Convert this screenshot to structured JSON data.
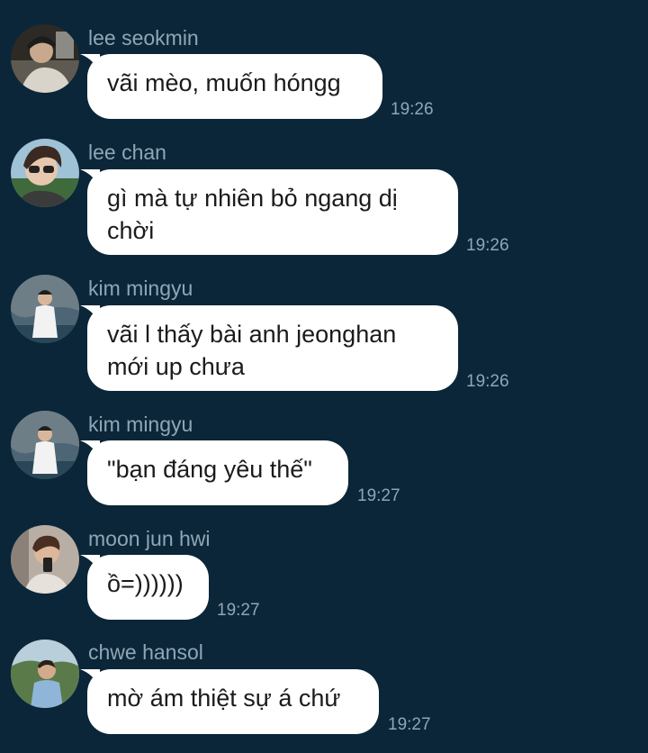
{
  "messages": [
    {
      "sender": "lee seokmin",
      "text": "vãi mèo, muốn hóngg",
      "time": "19:26",
      "avatar": "avatar-photo-lee-seokmin"
    },
    {
      "sender": "lee chan",
      "text": "gì mà tự nhiên bỏ ngang dị chời",
      "time": "19:26",
      "avatar": "avatar-photo-lee-chan"
    },
    {
      "sender": "kim mingyu",
      "text": "vãi l thấy bài anh jeonghan mới up chưa",
      "time": "19:26",
      "avatar": "avatar-photo-kim-mingyu"
    },
    {
      "sender": "kim mingyu",
      "text": "\"bạn đáng yêu thế\"",
      "time": "19:27",
      "avatar": "avatar-photo-kim-mingyu"
    },
    {
      "sender": "moon jun hwi",
      "text": "ồ=))))))",
      "time": "19:27",
      "avatar": "avatar-photo-moon-jun-hwi"
    },
    {
      "sender": "chwe hansol",
      "text": "mờ ám thiệt sự á chứ",
      "time": "19:27",
      "avatar": "avatar-photo-chwe-hansol"
    }
  ],
  "colors": {
    "background": "#0b2638",
    "bubble": "#ffffff",
    "meta_text": "#8fa6b6",
    "message_text": "#1b1b1b"
  }
}
